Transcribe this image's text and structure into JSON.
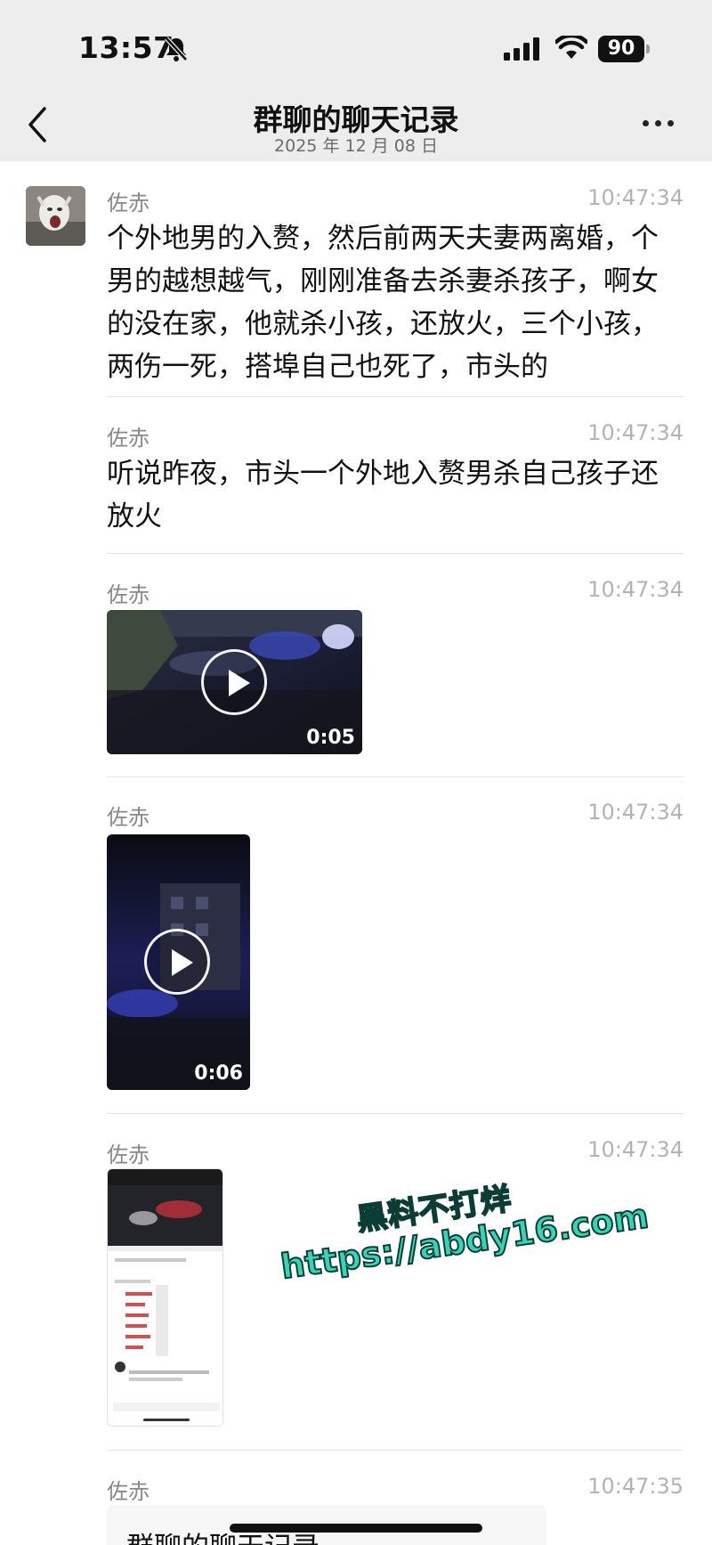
{
  "status_bar": {
    "time": "13:57",
    "battery": "90",
    "icons": [
      "bell-slash-icon",
      "signal-icon",
      "wifi-icon",
      "battery-icon"
    ]
  },
  "nav": {
    "title": "群聊的聊天记录",
    "subtitle": "2025 年 12 月 08 日",
    "back_icon": "chevron-left-icon",
    "more_icon": "ellipsis-icon"
  },
  "messages": [
    {
      "sender": "佐赤",
      "time": "10:47:34",
      "text": "个外地男的入赘，然后前两天夫妻两离婚，个男的越想越气，刚刚准备去杀妻杀孩子，啊女的没在家，他就杀小孩，还放火，三个小孩，两伤一死，搭埠自己也死了，市头的"
    },
    {
      "sender": "佐赤",
      "time": "10:47:34",
      "text": "听说昨夜，市头一个外地入赘男杀自己孩子还放火"
    },
    {
      "sender": "佐赤",
      "time": "10:47:34",
      "video_duration": "0:05"
    },
    {
      "sender": "佐赤",
      "time": "10:47:34",
      "video_duration": "0:06"
    },
    {
      "sender": "佐赤",
      "time": "10:47:34"
    },
    {
      "sender": "佐赤",
      "time": "10:47:35",
      "card_title": "群聊的聊天记录"
    }
  ],
  "watermark": {
    "line1": "黑料不打烊",
    "line2": "https://abdy16.com"
  },
  "colors": {
    "header_bg": "#ededed",
    "watermark": "#35d6b8",
    "timestamp": "#b3b3b3",
    "sender": "#888888"
  }
}
